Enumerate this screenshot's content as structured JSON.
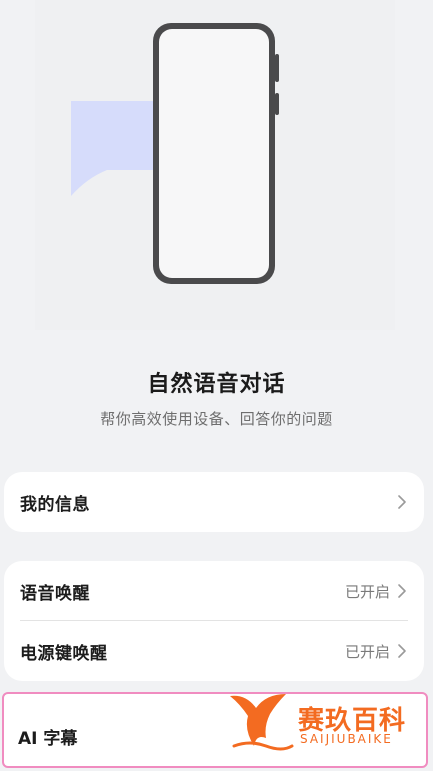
{
  "illustration": {
    "phone_icon": "phone-icon",
    "bubble_icon": "speech-bubble-icon"
  },
  "header": {
    "title": "自然语音对话",
    "subtitle": "帮你高效使用设备、回答你的问题"
  },
  "cards": {
    "my_info": {
      "label": "我的信息",
      "icon": "chevron-right-icon"
    },
    "voice_wake": {
      "label": "语音唤醒",
      "status": "已开启"
    },
    "power_wake": {
      "label": "电源键唤醒",
      "status": "已开启"
    },
    "ai_subtitle": {
      "label": "AI 字幕"
    }
  },
  "watermark": {
    "cn": "赛玖百科",
    "en": "SAIJIUBAIKE"
  },
  "colors": {
    "background": "#f1f2f4",
    "card": "#ffffff",
    "bubble": "#d6dcfb",
    "highlight_border": "#f08cc0",
    "watermark": "#f36b21"
  }
}
